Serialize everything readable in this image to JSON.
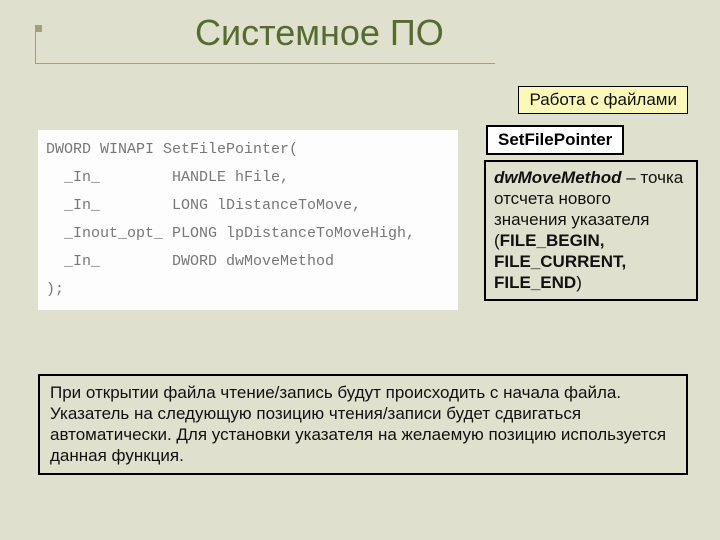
{
  "title": "Системное ПО",
  "subtitle": "Работа с файлами",
  "api_name": "SetFilePointer",
  "code": "DWORD WINAPI SetFilePointer(\n  _In_        HANDLE hFile,\n  _In_        LONG lDistanceToMove,\n  _Inout_opt_ PLONG lpDistanceToMoveHigh,\n  _In_        DWORD dwMoveMethod\n);",
  "param": {
    "name": "dwMoveMethod",
    "dash": " – ",
    "text": "точка отсчета нового значения указателя (",
    "enum": "FILE_BEGIN, FILE_CURRENT, FILE_END",
    "close": ")"
  },
  "description": "При открытии файла чтение/запись будут происходить с начала файла. Указатель на следующую позицию чтения/записи будет сдвигаться автоматически. Для установки указателя на желаемую позицию используется данная функция."
}
